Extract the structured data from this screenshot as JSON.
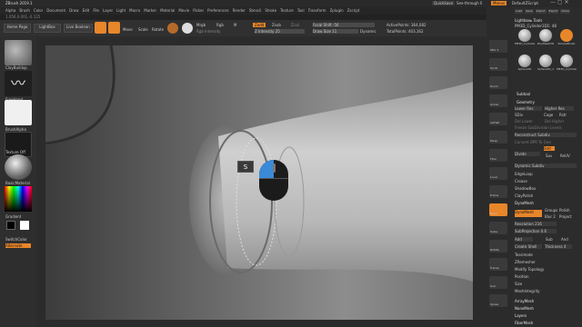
{
  "window": {
    "title": "ZBrush 2019.1"
  },
  "menu": [
    "Alpha",
    "Brush",
    "Color",
    "Document",
    "Draw",
    "Edit",
    "File",
    "Layer",
    "Light",
    "Macro",
    "Marker",
    "Material",
    "Movie",
    "Picker",
    "Preferences",
    "Render",
    "Stencil",
    "Stroke",
    "Texture",
    "Tool",
    "Transform",
    "Zplugin",
    "Zscript"
  ],
  "quicksave": "QuickSave",
  "see_through": "See-through 0",
  "menus_label": "Menus",
  "default_script": "DefaultZScript",
  "info": "1.056,0.001,-0.125",
  "toolbar": {
    "home": "Home Page",
    "lightbox": "LightBox",
    "live_boolean": "Live Boolean",
    "edit": "Edit",
    "draw": "Draw",
    "move": "Move",
    "scale": "Scale",
    "rotate": "Rotate",
    "mrgb": "Mrgb",
    "rgb": "Rgb",
    "m": "M",
    "zadd": "Zadd",
    "zsub": "Zsub",
    "zcut": "Zcut",
    "rgb_intensity": "Rgb Intensity",
    "z_intensity": "Z Intensity 25",
    "focal_shift": "Focal Shift -56",
    "draw_size": "Draw Size 11",
    "dynamic": "Dynamic",
    "active_points": "ActivePoints: 364,082",
    "total_points": "TotalPoints: 403,162"
  },
  "left": {
    "brush": "ClayBuildup",
    "stroke": "FreeHand",
    "alpha": "BrushAlpha",
    "texture": "Texture Off",
    "material": "BasicMaterial",
    "gradient": "Gradient",
    "switch": "SwitchColor",
    "alternate": "Alternate"
  },
  "cursor": {
    "key": "S"
  },
  "right_shelf": [
    "SPix 3",
    "Scroll",
    "Zoom",
    "Actual",
    "AAHalf",
    "Persp",
    "Floor",
    "Local",
    "Frame",
    "Move",
    "Scale",
    "Rotate",
    "Transp",
    "Solo",
    "Xpose"
  ],
  "tray": {
    "top": [
      "Load",
      "Save",
      "Import",
      "Export",
      "Clone",
      "Make PolyMesh3D",
      "GoZ",
      "All",
      "Visible",
      "R"
    ],
    "lightbox_tools": "Lightbox▸ Tools",
    "tool_name": "PM3D_Cylinder3D1: 48",
    "thumbs": [
      "PM3D_Cylinder3",
      "PolyMesh3D",
      "SimpleBrush",
      "Sphere3D",
      "Sphere3D_1",
      "PM3D_Cylinder3"
    ],
    "subtool": "Subtool",
    "geometry": "Geometry",
    "lower_res": "Lower Res",
    "higher_res": "Higher Res",
    "sdiv": "SDiv",
    "cage": "Cage",
    "rstr": "Rstr",
    "del_lower": "Del Lower",
    "del_higher": "Del Higher",
    "freeze": "Freeze SubDivision Levels",
    "reconstruct": "Reconstruct Subdiv",
    "convert": "Convert BPR To Geo",
    "divide": "Divide",
    "smt": "Smt",
    "suv": "Suv",
    "rsuv": "ReUV",
    "dynamic_subdiv": "Dynamic Subdiv",
    "edgeloop": "EdgeLoop",
    "crease": "Crease",
    "shadowbox": "ShadowBox",
    "claypolish": "ClayPolish",
    "dynamesh_hd": "DynaMesh",
    "dynamesh": "DynaMesh",
    "groups": "Groups",
    "polish": "Polish",
    "blur": "Blur 2",
    "project": "Project",
    "resolution": "Resolution 216",
    "subprojection": "SubProjection 0.6",
    "add": "Add",
    "sub": "Sub",
    "and": "And",
    "create_shell": "Create Shell",
    "thickness": "Thickness 4",
    "tessimate": "Tessimate",
    "zremesher": "ZRemesher",
    "modify_topology": "Modify Topology",
    "position": "Position",
    "size": "Size",
    "meshintegrity": "MeshIntegrity",
    "arraymesh": "ArrayMesh",
    "nanomesh": "NanoMesh",
    "layers": "Layers",
    "fibermesh": "FiberMesh"
  },
  "colors": {
    "accent": "#e8862a",
    "bg": "#2b2b2b"
  }
}
